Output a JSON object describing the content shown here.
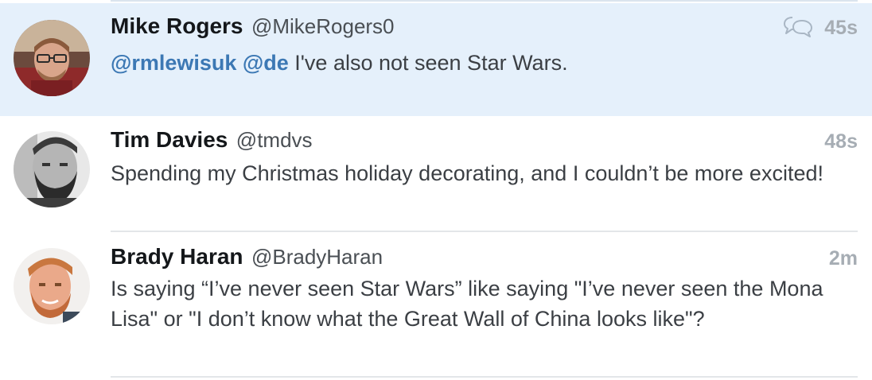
{
  "tweets": [
    {
      "name": "Mike Rogers",
      "handle": "@MikeRogers0",
      "time": "45s",
      "highlighted": true,
      "mentions": [
        "@rmlewisuk",
        "@de"
      ],
      "text": "I've also not seen Star Wars."
    },
    {
      "name": "Tim Davies",
      "handle": "@tmdvs",
      "time": "48s",
      "highlighted": false,
      "text": "Spending my Christmas holiday decorating, and I couldn’t be more excited!"
    },
    {
      "name": "Brady Haran",
      "handle": "@BradyHaran",
      "time": "2m",
      "highlighted": false,
      "text": "Is saying “I’ve never seen Star Wars” like saying \"I’ve never seen the Mona Lisa\" or \"I don’t know what the Great Wall of China looks like\"?"
    }
  ],
  "icons": {
    "reply": "conversation-icon"
  },
  "colors": {
    "highlight_bg": "#e5f0fb",
    "mention": "#3c78b4",
    "timestamp": "#a6adb4"
  }
}
